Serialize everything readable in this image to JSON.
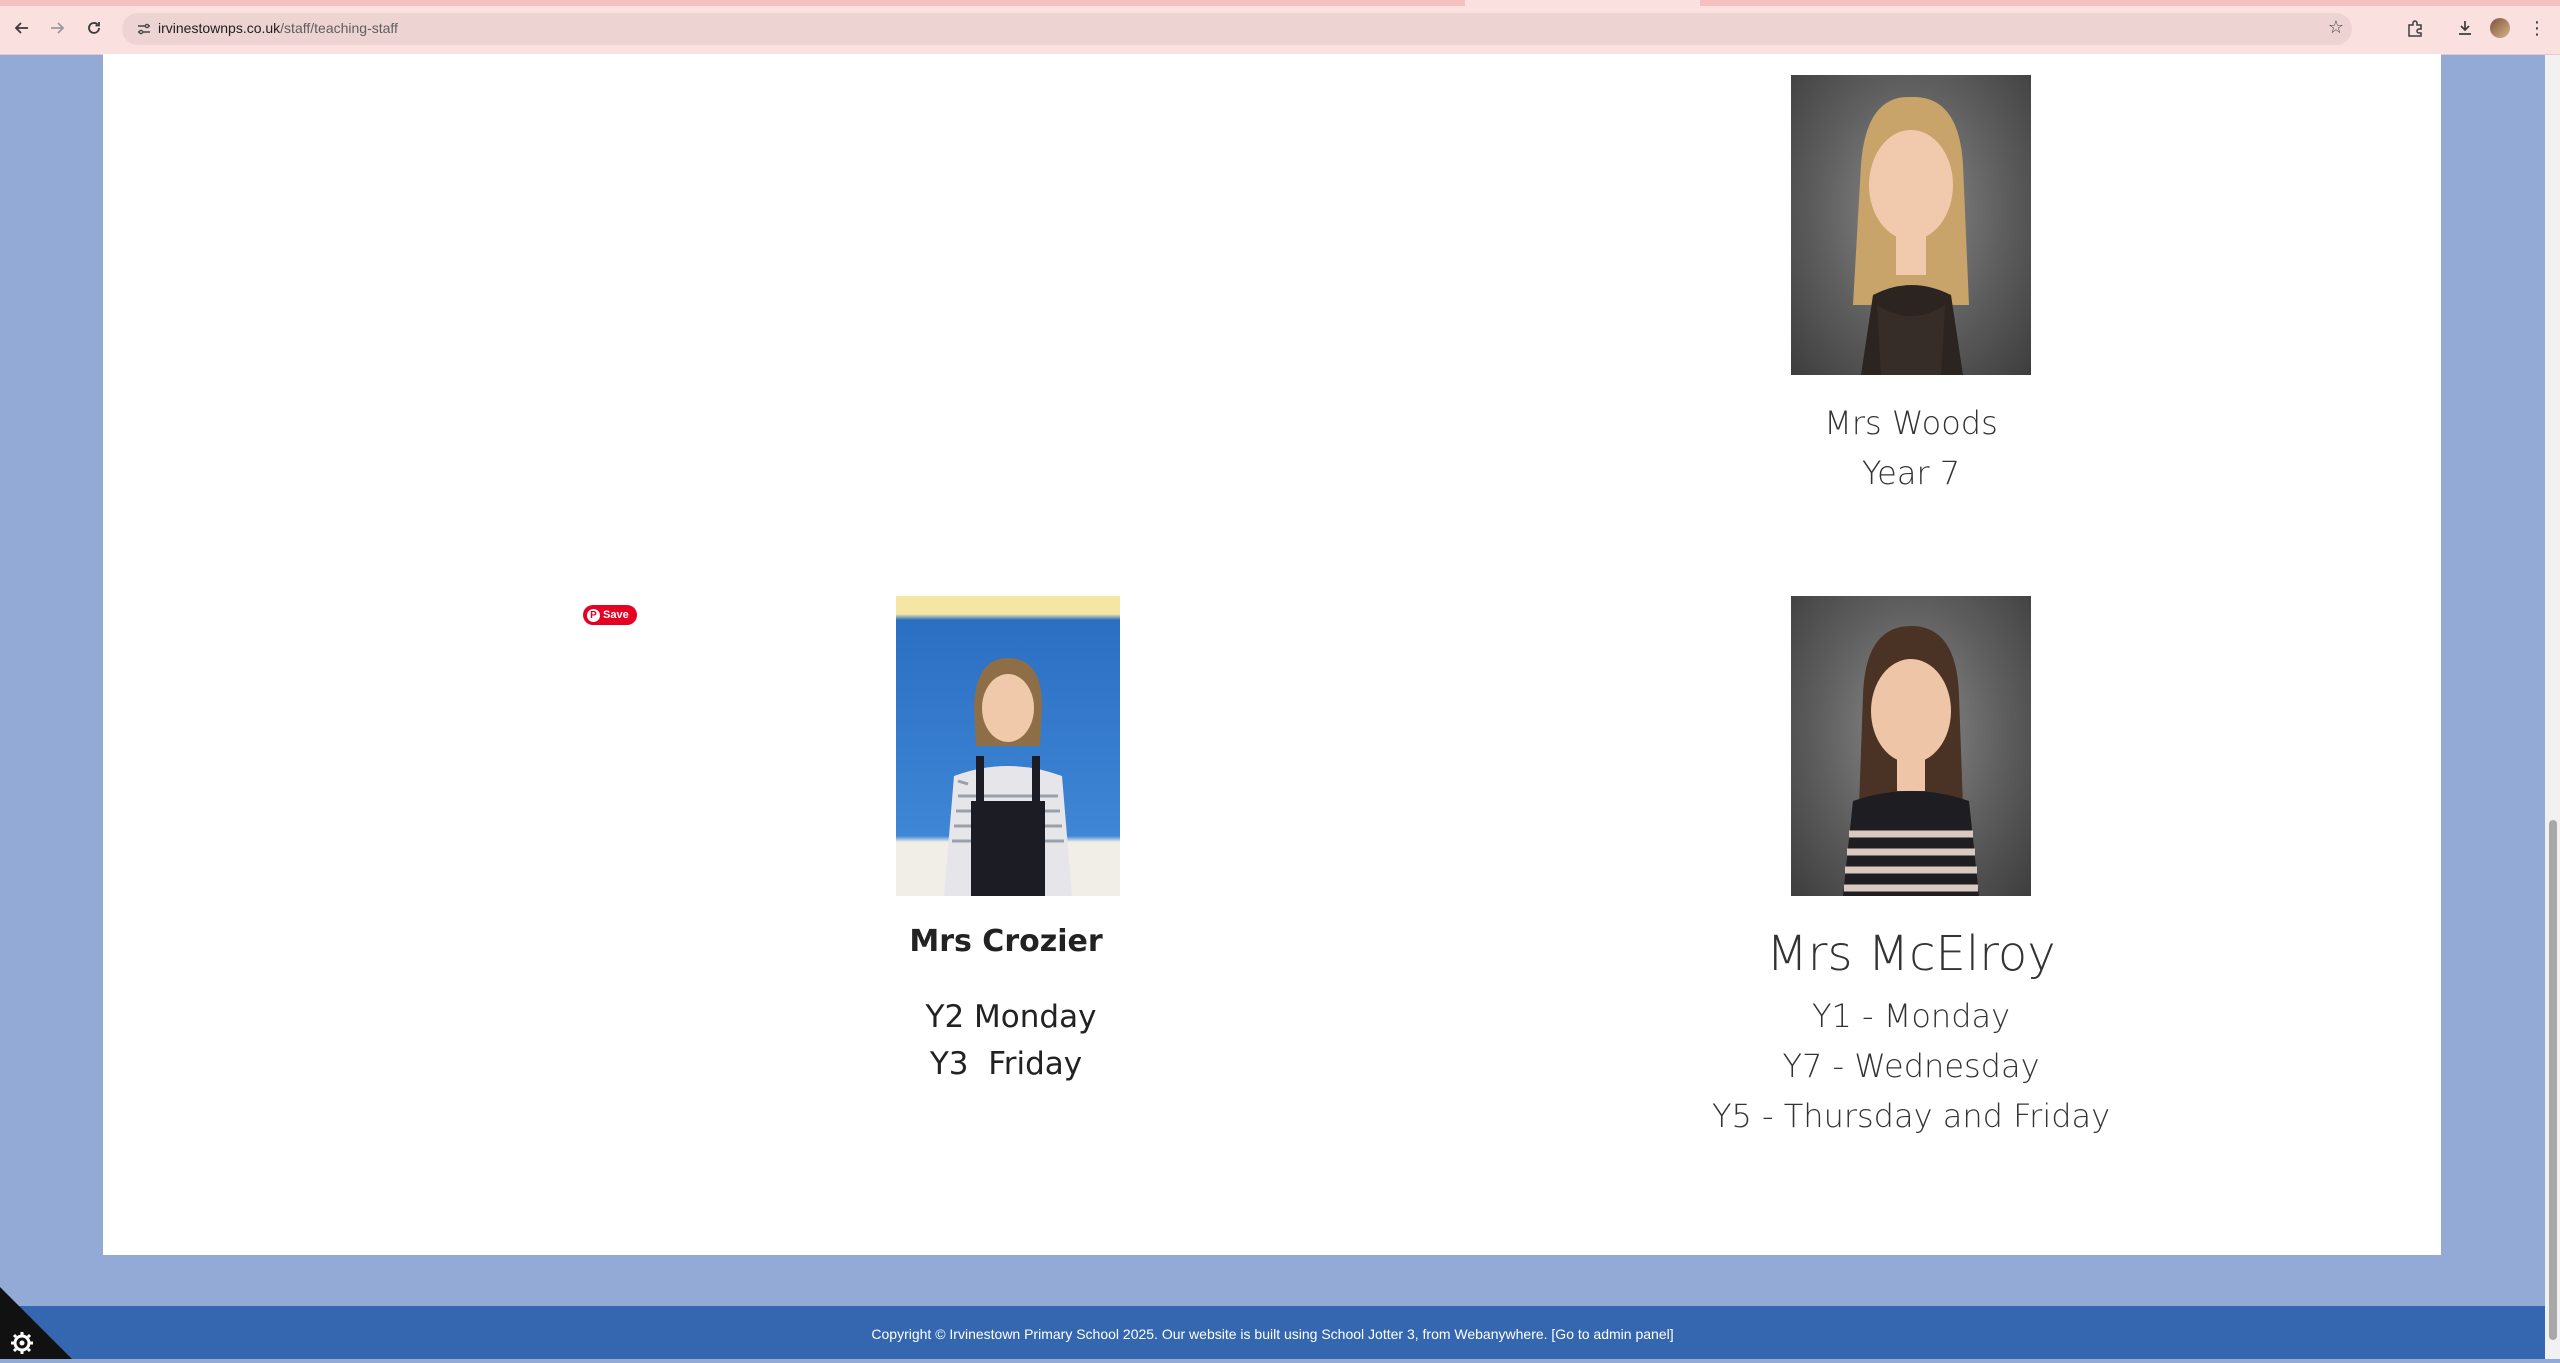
{
  "browser": {
    "url_host": "irvinestownps.co.uk",
    "url_path": "/staff/teaching-staff"
  },
  "staff": {
    "woods": {
      "name": "Mrs Woods",
      "role": "Year 7"
    },
    "crozier": {
      "name": "Mrs Crozier",
      "role_line1": "Y2 Monday",
      "role_line2": "Y3  Friday"
    },
    "mcelroy": {
      "name": "Mrs McElroy",
      "role_line1": "Y1 - Monday",
      "role_line2": "Y7 - Wednesday",
      "role_line3": "Y5 - Thursday and Friday"
    }
  },
  "pinterest": {
    "save_label": "Save"
  },
  "footer": {
    "text": "Copyright © Irvinestown Primary School 2025. Our website is built using School Jotter 3, from Webanywhere. [Go to admin panel]"
  },
  "icons": {
    "back": "arrow-left-icon",
    "forward": "arrow-right-icon",
    "reload": "reload-icon",
    "site-info": "tune-icon",
    "bookmark": "star-icon",
    "extensions": "puzzle-icon",
    "downloads": "download-icon",
    "menu": "kebab-menu-icon",
    "accessibility": "gear-icon"
  },
  "colors": {
    "page_background": "#93a9d6",
    "footer": "#3567b0",
    "pinterest": "#e60023"
  }
}
